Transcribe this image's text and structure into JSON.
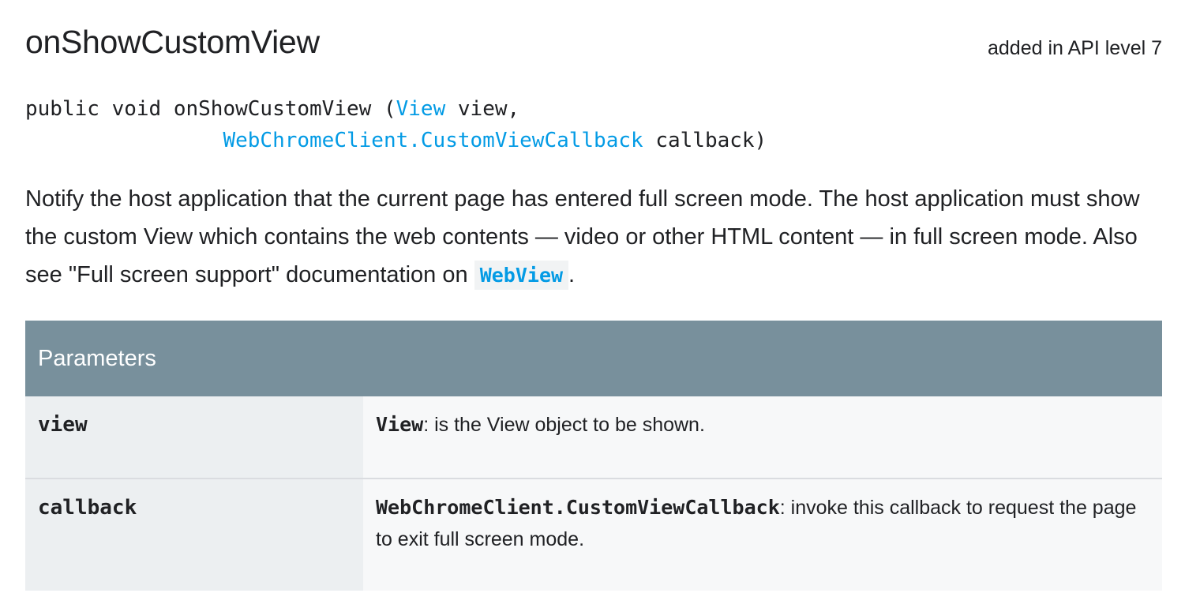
{
  "method": {
    "name": "onShowCustomView",
    "api_level": "added in API level 7"
  },
  "signature": {
    "prefix": "public void onShowCustomView (",
    "param1_type": "View",
    "param1_name": " view,",
    "indent": "                ",
    "param2_type": "WebChromeClient.CustomViewCallback",
    "param2_name": " callback)"
  },
  "description": {
    "text": "Notify the host application that the current page has entered full screen mode. The host application must show the custom View which contains the web contents — video or other HTML content — in full screen mode. Also see \"Full screen support\" documentation on ",
    "link": "WebView",
    "suffix": "."
  },
  "parameters": {
    "header": "Parameters",
    "rows": [
      {
        "name": "view",
        "type": "View",
        "desc": ": is the View object to be shown."
      },
      {
        "name": "callback",
        "type": "WebChromeClient.CustomViewCallback",
        "desc": ": invoke this callback to request the page to exit full screen mode."
      }
    ]
  },
  "colors": {
    "link": "#039be5",
    "table_header": "#78909c",
    "name_cell": "#eceff1"
  }
}
